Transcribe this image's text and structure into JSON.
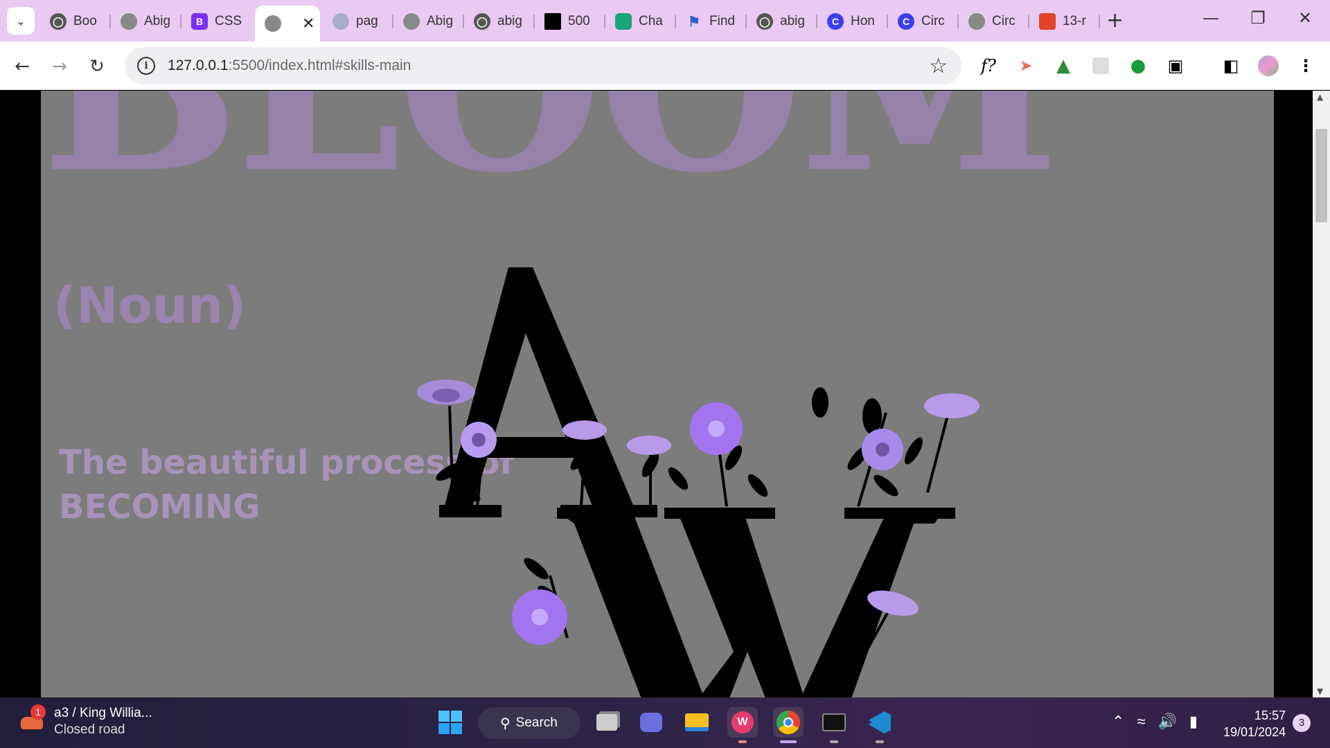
{
  "browser": {
    "tabs": [
      {
        "label": "Boo",
        "icon": "github-icon"
      },
      {
        "label": "Abig",
        "icon": "globe-icon"
      },
      {
        "label": "CSS",
        "icon": "bootstrap-icon"
      },
      {
        "label": "",
        "icon": "globe-icon",
        "active": true
      },
      {
        "label": "pag",
        "icon": "globe-check-icon"
      },
      {
        "label": "Abig",
        "icon": "globe-icon"
      },
      {
        "label": "abig",
        "icon": "github-icon"
      },
      {
        "label": "500",
        "icon": "unsplash-icon"
      },
      {
        "label": "Cha",
        "icon": "chatgpt-icon"
      },
      {
        "label": "Find",
        "icon": "flag-icon"
      },
      {
        "label": "abig",
        "icon": "github-icon"
      },
      {
        "label": "Hon",
        "icon": "canva-icon"
      },
      {
        "label": "Circ",
        "icon": "canva-icon"
      },
      {
        "label": "Circ",
        "icon": "globe-icon"
      },
      {
        "label": "13-r",
        "icon": "gitlab-icon"
      }
    ],
    "url_host": "127.0.0.1",
    "url_rest": ":5500/index.html#skills-main"
  },
  "page": {
    "bloom_word": "BLOOM",
    "noun": "(Noun)",
    "tagline_line1": "The beautiful process of",
    "tagline_line2": "BECOMING",
    "accent_color": "#9681a9",
    "background_color": "#7c7c7c"
  },
  "taskbar": {
    "weather_badge": "1",
    "weather_title": "a3 / King Willia...",
    "weather_subtitle": "Closed road",
    "search_label": "Search",
    "time": "15:57",
    "date": "19/01/2024",
    "notification_count": "3"
  }
}
